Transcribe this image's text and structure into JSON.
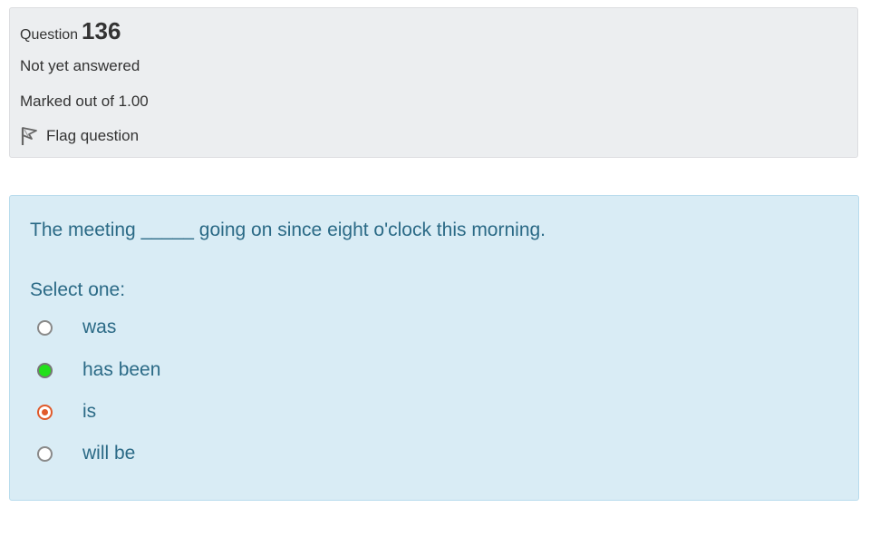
{
  "info": {
    "question_word": "Question",
    "question_number": "136",
    "state": "Not yet answered",
    "grade": "Marked out of 1.00",
    "flag_label": "Flag question"
  },
  "formulation": {
    "question_text": "The meeting _____ going on since eight o'clock this morning.",
    "prompt": "Select one:",
    "options": [
      {
        "label": "was",
        "state": "unselected"
      },
      {
        "label": "has been",
        "state": "correct"
      },
      {
        "label": "is",
        "state": "selected"
      },
      {
        "label": "will be",
        "state": "unselected"
      }
    ]
  },
  "colors": {
    "info_bg": "#eceef0",
    "formulation_bg": "#d9ecf5",
    "text_blue": "#2b6a86",
    "correct_green": "#22e01a",
    "selected_orange": "#e05a2b"
  },
  "icons": {
    "flag": "flag-icon"
  }
}
